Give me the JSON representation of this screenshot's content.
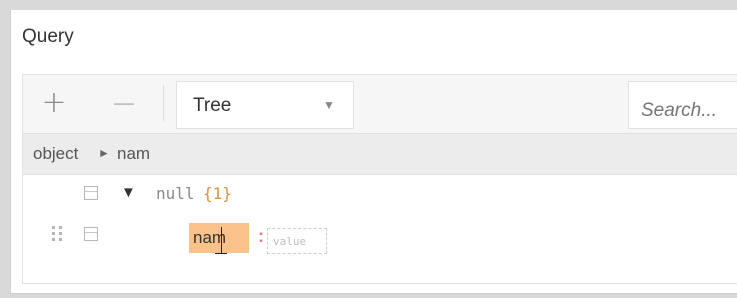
{
  "panel": {
    "title": "Query"
  },
  "toolbar": {
    "add_icon": "+",
    "remove_icon": "—",
    "mode_label": "Tree",
    "mode_arrow": "▼",
    "search_placeholder": "Search..."
  },
  "breadcrumb": {
    "items": [
      "object",
      "nam"
    ],
    "separator": "►"
  },
  "tree": {
    "root": {
      "expand_icon": "▼",
      "key": "null",
      "count": "{1}"
    },
    "child": {
      "key": "nam",
      "colon": ":",
      "value_placeholder": "value"
    }
  }
}
